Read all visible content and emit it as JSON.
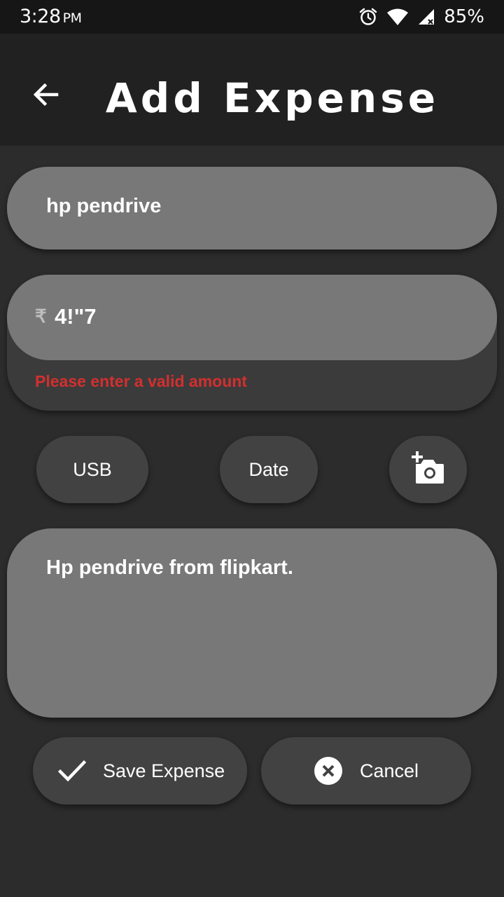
{
  "status_bar": {
    "time": "3:28",
    "ampm": "PM",
    "battery": "85%",
    "icons": [
      "alarm-icon",
      "wifi-icon",
      "cellular-signal-icon"
    ]
  },
  "header": {
    "title": "Add Expense",
    "back_icon": "arrow-back-icon"
  },
  "form": {
    "title_value": "hp pendrive",
    "currency_symbol": "₹",
    "amount_value": "4!\"7",
    "amount_error": "Please enter a valid amount",
    "category_label": "USB",
    "date_label": "Date",
    "camera_icon": "add-a-photo-icon",
    "notes_value": "Hp pendrive from flipkart."
  },
  "actions": {
    "save_label": "Save Expense",
    "save_icon": "check-icon",
    "cancel_label": "Cancel",
    "cancel_icon": "cancel-icon"
  },
  "colors": {
    "background": "#2c2c2c",
    "app_bar": "#212121",
    "status_bar": "#161616",
    "field": "#787878",
    "chip": "#424242",
    "error": "#d32f2f",
    "text": "#ffffff"
  }
}
